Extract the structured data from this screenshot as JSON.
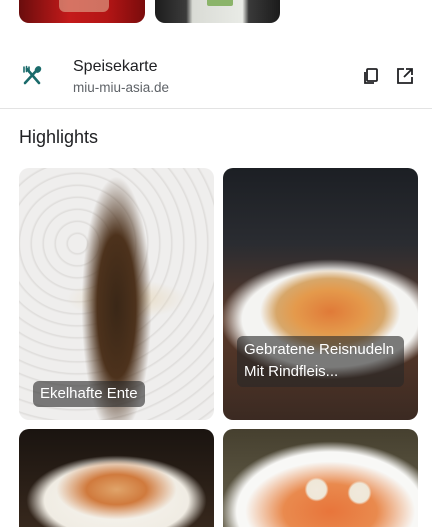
{
  "top_thumbnails": [
    "photo-thumbnail",
    "menu-photo-thumbnail"
  ],
  "menu_link": {
    "title": "Speisekarte",
    "url": "miu-miu-asia.de",
    "icon": "fork-knife-icon",
    "copy_icon": "copy-icon",
    "open_icon": "open-in-new-icon"
  },
  "highlights": {
    "title": "Highlights",
    "cards": [
      {
        "label": "Ekelhafte Ente"
      },
      {
        "label": "Gebratene Reisnudeln Mit Rindfleis..."
      },
      {
        "label": ""
      },
      {
        "label": ""
      }
    ]
  },
  "colors": {
    "icon_teal": "#1a6b6b",
    "text_primary": "#202124",
    "text_secondary": "#5f6368",
    "divider": "#e3e3e3"
  }
}
